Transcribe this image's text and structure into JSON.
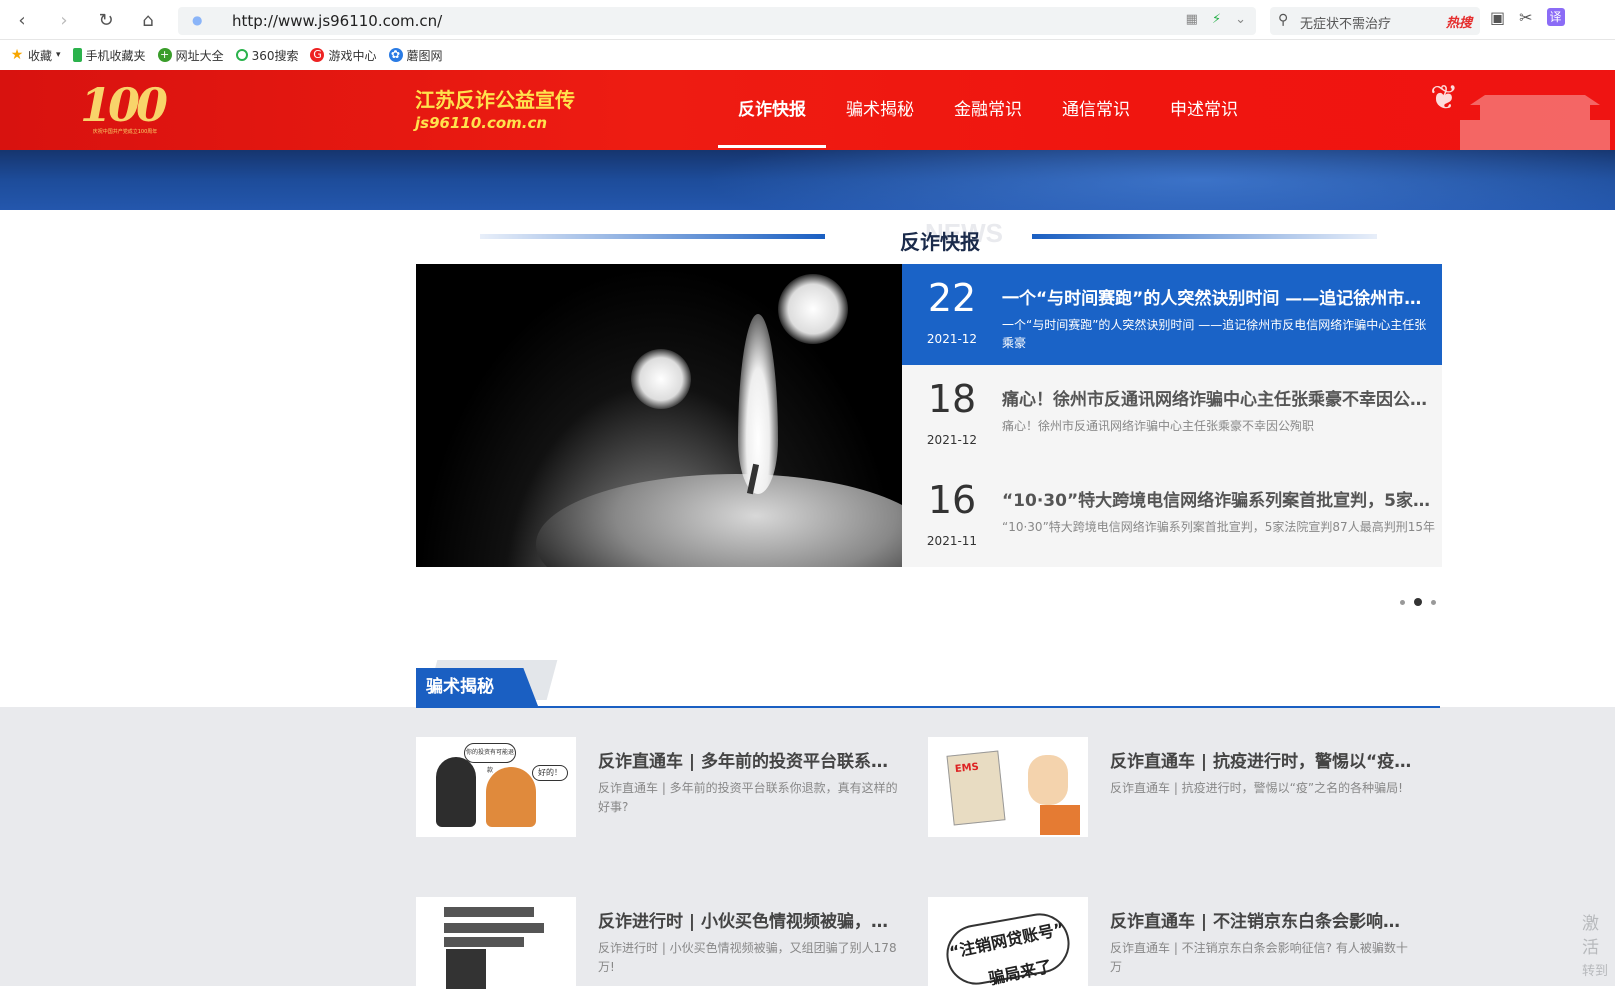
{
  "browser": {
    "url": "http://www.js96110.com.cn/",
    "search_placeholder": "无症状不需治疗",
    "hot_label": "热搜",
    "translate_label": "译"
  },
  "bookmarks": [
    {
      "label": "收藏",
      "icon": "star-icon"
    },
    {
      "label": "手机收藏夹",
      "icon": "phone-icon"
    },
    {
      "label": "网址大全",
      "icon": "globe-icon"
    },
    {
      "label": "360搜索",
      "icon": "search-360-icon"
    },
    {
      "label": "游戏中心",
      "icon": "game-icon"
    },
    {
      "label": "蘑图网",
      "icon": "photo-icon"
    }
  ],
  "site": {
    "logo_digits": "100",
    "logo_caption": "庆祝中国共产党成立100周年",
    "title": "江苏反诈公益宣传",
    "domain": "js96110.com.cn",
    "nav": [
      {
        "label": "反诈快报",
        "active": true
      },
      {
        "label": "骗术揭秘",
        "active": false
      },
      {
        "label": "金融常识",
        "active": false
      },
      {
        "label": "通信常识",
        "active": false
      },
      {
        "label": "申述常识",
        "active": false
      }
    ]
  },
  "news_section": {
    "title": "反诈快报",
    "ghost": "NEWS",
    "items": [
      {
        "day": "22",
        "ym": "2021-12",
        "title": "一个“与时间赛跑”的人突然诀别时间 ——追记徐州市反电信网络诈骗中心主任张乘豪",
        "desc": "一个“与时间赛跑”的人突然诀别时间 ——追记徐州市反电信网络诈骗中心主任张乘豪",
        "active": true
      },
      {
        "day": "18",
        "ym": "2021-12",
        "title": "痛心！徐州市反通讯网络诈骗中心主任张乘豪不幸因公殉职",
        "desc": "痛心！徐州市反通讯网络诈骗中心主任张乘豪不幸因公殉职",
        "active": false
      },
      {
        "day": "16",
        "ym": "2021-11",
        "title": "“10·30”特大跨境电信网络诈骗系列案首批宣判，5家法院宣判87人最高判刑15年",
        "desc": "“10·30”特大跨境电信网络诈骗系列案首批宣判，5家法院宣判87人最高判刑15年",
        "active": false
      }
    ],
    "pager_active": 2
  },
  "scam_section": {
    "tab": "骗术揭秘",
    "cards": [
      {
        "title": "反诈直通车 | 多年前的投资平台联系你退款，真有这样的好事?",
        "desc": "反诈直通车 | 多年前的投资平台联系你退款，真有这样的好事?",
        "thumb_bubble": "你的投资有可能退款",
        "thumb_bubble2": "好的！"
      },
      {
        "title": "反诈直通车 | 抗疫进行时，警惕以“疫”之名的各种骗局!",
        "desc": "反诈直通车 | 抗疫进行时，警惕以“疫”之名的各种骗局!",
        "thumb_label": "EMS"
      },
      {
        "title": "反诈进行时 | 小伙买色情视频被骗，又组团骗了别人178万!",
        "desc": "反诈进行时 | 小伙买色情视频被骗，又组团骗了别人178万!"
      },
      {
        "title": "反诈直通车 | 不注销京东白条会影响征信? 有人被骗数十万",
        "desc": "反诈直通车 | 不注销京东白条会影响征信? 有人被骗数十万",
        "thumb_text1": "“注销网贷账号”",
        "thumb_text2": "骗局来了"
      }
    ]
  },
  "watermark": {
    "line1": "激活",
    "line2": "转到"
  }
}
